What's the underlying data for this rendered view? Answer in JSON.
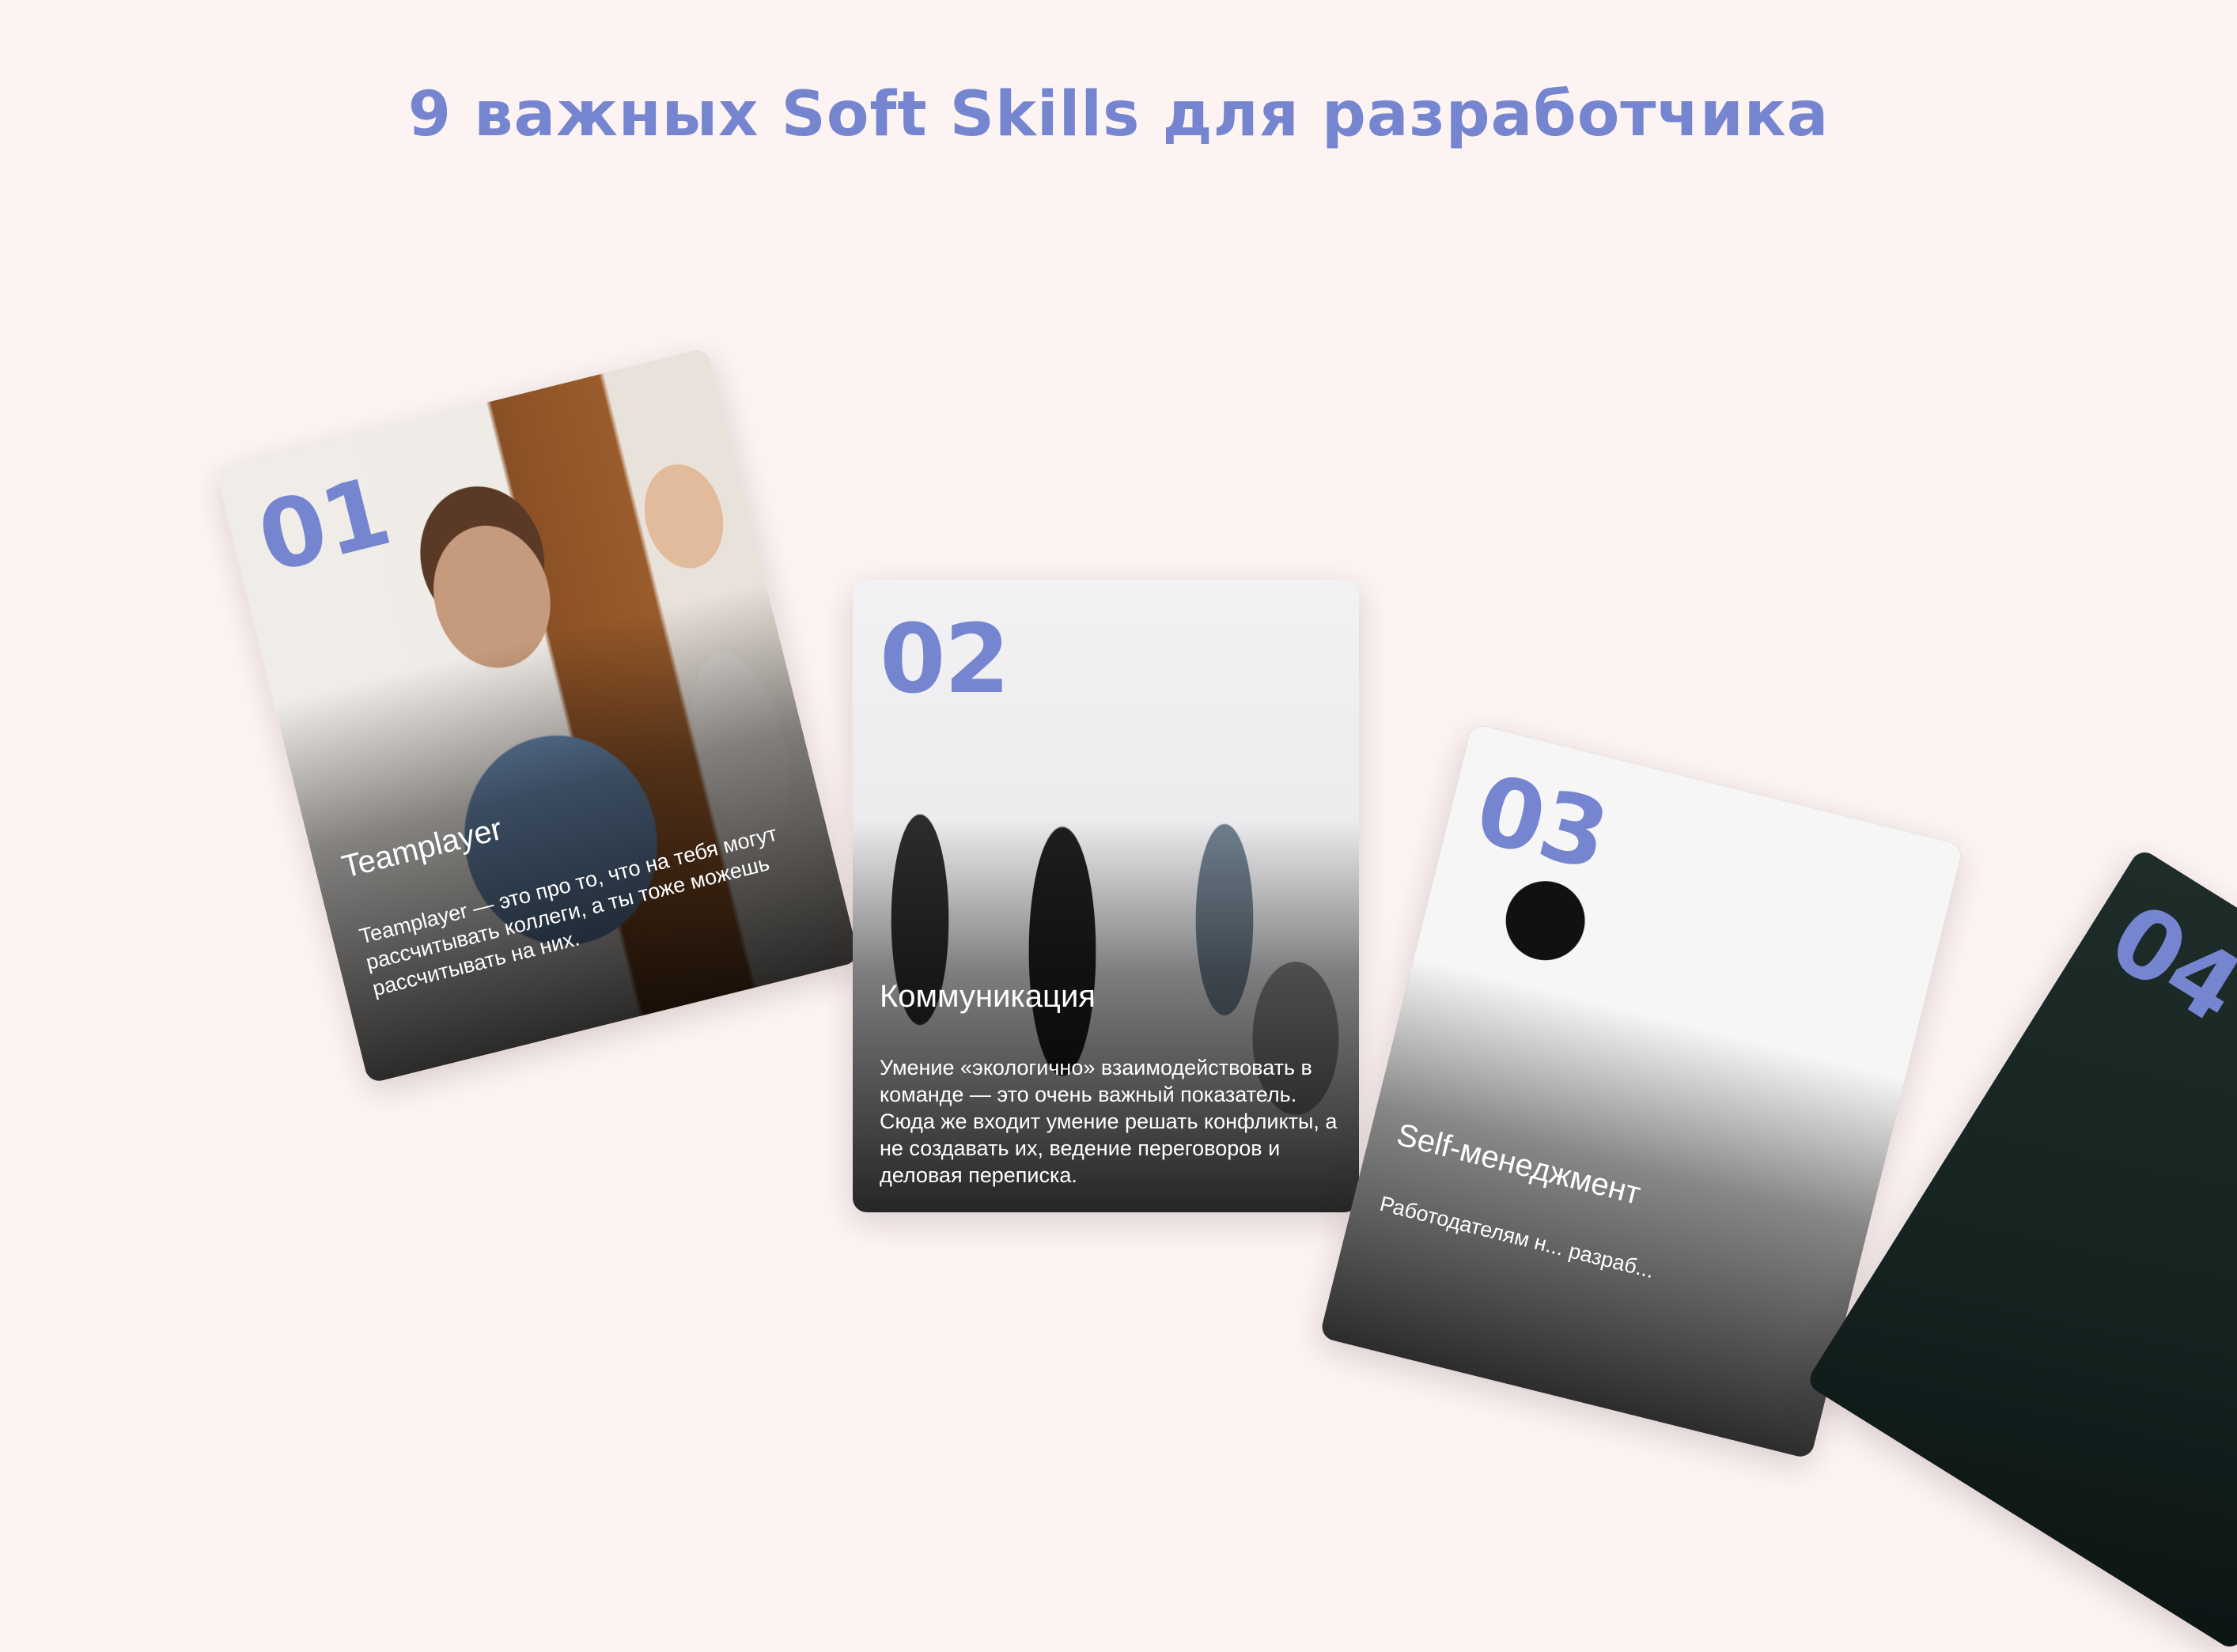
{
  "page": {
    "title": "9 важных Soft Skills для разработчика",
    "background_color": "#fcf3f2",
    "accent_color": "#7585cf"
  },
  "cards": [
    {
      "number": "01",
      "title": "Teamplayer",
      "text": "Teamplayer — это про то, что на тебя могут рассчитывать коллеги, а ты тоже можешь рассчитывать на них."
    },
    {
      "number": "02",
      "title": "Коммуникация",
      "text": "Умение «экологично» взаимодействовать в команде — это очень важный показатель. Сюда же входит умение решать конфликты, а не создавать их, ведение переговоров и деловая переписка."
    },
    {
      "number": "03",
      "title": "Self-менеджмент",
      "text": "Работодателям н... разраб..."
    },
    {
      "number": "04",
      "title": "",
      "text": ""
    }
  ]
}
